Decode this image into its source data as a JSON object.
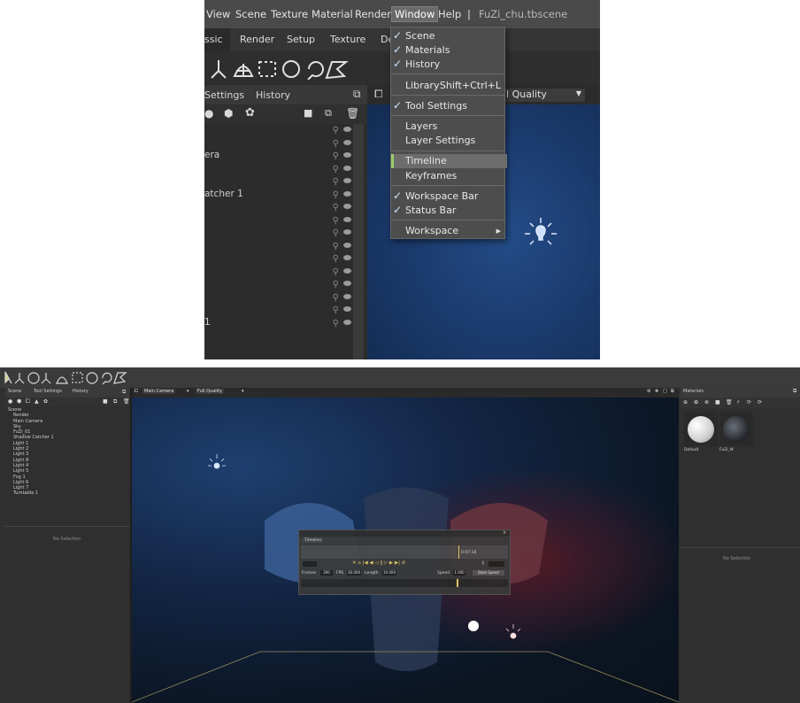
{
  "zoom": {
    "menubar": {
      "items": [
        "View",
        "Scene",
        "Texture",
        "Material",
        "Render",
        "Window",
        "Help",
        "|",
        "FuZi_chu.tbscene"
      ]
    },
    "tabs": [
      "ssic",
      "Render",
      "Setup",
      "Texture",
      "De"
    ],
    "panel_tabs": [
      "Settings",
      "History"
    ],
    "rows": [
      "",
      "",
      "era",
      "",
      "",
      "atcher 1",
      "",
      "",
      "",
      "",
      "",
      "",
      "",
      "",
      "",
      "1"
    ],
    "quality": "ll Quality",
    "window_menu": {
      "items": [
        {
          "label": "Scene",
          "checked": true,
          "shortcut": ""
        },
        {
          "label": "Materials",
          "checked": true,
          "shortcut": ""
        },
        {
          "label": "History",
          "checked": true,
          "shortcut": ""
        },
        {
          "label": "Library",
          "checked": false,
          "shortcut": "Shift+Ctrl+L"
        },
        {
          "label": "Tool Settings",
          "checked": true,
          "shortcut": ""
        },
        {
          "label": "Layers",
          "checked": false,
          "shortcut": ""
        },
        {
          "label": "Layer Settings",
          "checked": false,
          "shortcut": ""
        },
        {
          "label": "Timeline",
          "checked": false,
          "shortcut": "",
          "highlighted": true
        },
        {
          "label": "Keyframes",
          "checked": false,
          "shortcut": ""
        },
        {
          "label": "Workspace Bar",
          "checked": true,
          "shortcut": ""
        },
        {
          "label": "Status Bar",
          "checked": true,
          "shortcut": ""
        },
        {
          "label": "Workspace",
          "checked": false,
          "shortcut": "",
          "submenu": true
        }
      ]
    }
  },
  "full": {
    "left_tabs": [
      "Scene",
      "Tool Settings",
      "History"
    ],
    "tree": [
      "Scene",
      "Render",
      "Main Camera",
      "Sky",
      "FuZi_01",
      "Shadow Catcher 1",
      "Light 1",
      "Light 2",
      "Light 3",
      "Light 8",
      "Light 4",
      "Light 5",
      "Fog 1",
      "Light 6",
      "Light 7",
      "Turntable 1"
    ],
    "no_selection": "No Selection",
    "viewport": {
      "camera": "Main Camera",
      "quality": "Full Quality"
    },
    "materials_tab": "Materials",
    "materials": [
      "Default",
      "FuZi_M"
    ],
    "timeline": {
      "title": "Timeline",
      "current_time": "0:07.18",
      "frames_label": "Frames",
      "frames": "300",
      "fps_label": "FPS",
      "fps": "30.000",
      "length_label": "Length",
      "length": "10.000",
      "speed_label": "Speed",
      "speed": "1.000",
      "bake_label": "Bake Speed"
    }
  },
  "colors": {
    "accent_green": "#9acb6a",
    "viewport_blue": "#1a3869"
  }
}
